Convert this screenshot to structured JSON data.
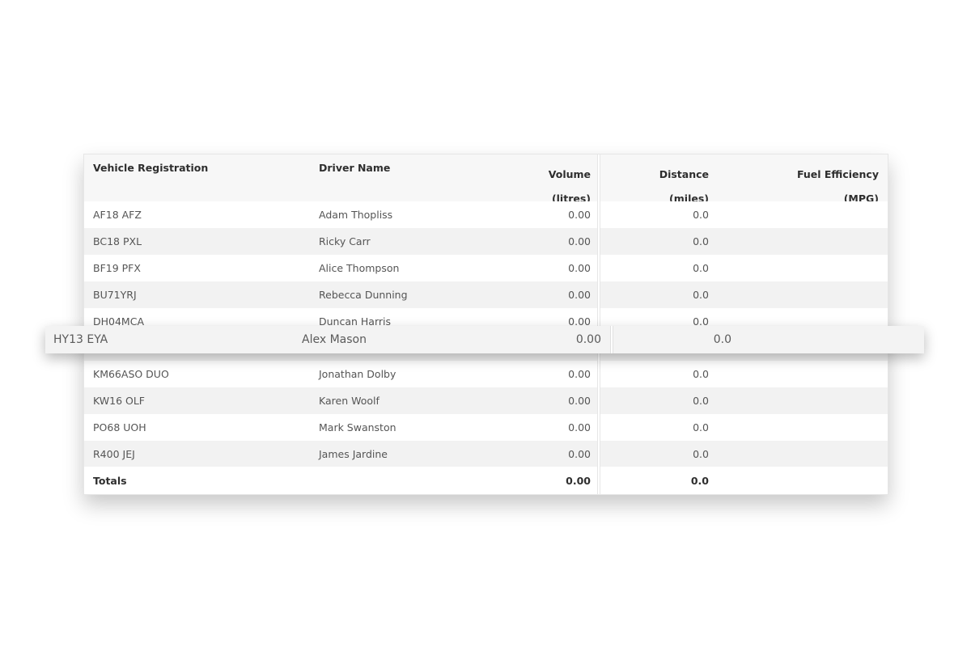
{
  "table": {
    "columns": {
      "registration": "Vehicle Registration",
      "driver": "Driver Name",
      "volume": "Volume",
      "volume_unit": "(litres)",
      "distance": "Distance",
      "distance_unit": "(miles)",
      "efficiency": "Fuel Efficiency",
      "efficiency_unit": "(MPG)"
    },
    "rows": [
      {
        "registration": "AF18 AFZ",
        "driver": "Adam Thopliss",
        "volume": "0.00",
        "distance": "0.0",
        "efficiency": ""
      },
      {
        "registration": "BC18 PXL",
        "driver": "Ricky Carr",
        "volume": "0.00",
        "distance": "0.0",
        "efficiency": ""
      },
      {
        "registration": "BF19 PFX",
        "driver": "Alice Thompson",
        "volume": "0.00",
        "distance": "0.0",
        "efficiency": ""
      },
      {
        "registration": "BU71YRJ",
        "driver": "Rebecca Dunning",
        "volume": "0.00",
        "distance": "0.0",
        "efficiency": ""
      },
      {
        "registration": "DH04MCA",
        "driver": "Duncan Harris",
        "volume": "0.00",
        "distance": "0.0",
        "efficiency": ""
      },
      {
        "registration": "",
        "driver": "",
        "volume": "",
        "distance": "",
        "efficiency": ""
      },
      {
        "registration": "KM66ASO DUO",
        "driver": "Jonathan Dolby",
        "volume": "0.00",
        "distance": "0.0",
        "efficiency": ""
      },
      {
        "registration": "KW16 OLF",
        "driver": "Karen Woolf",
        "volume": "0.00",
        "distance": "0.0",
        "efficiency": ""
      },
      {
        "registration": "PO68 UOH",
        "driver": "Mark Swanston",
        "volume": "0.00",
        "distance": "0.0",
        "efficiency": ""
      },
      {
        "registration": "R400 JEJ",
        "driver": "James Jardine",
        "volume": "0.00",
        "distance": "0.0",
        "efficiency": ""
      }
    ],
    "highlighted_row": {
      "registration": "HY13 EYA",
      "driver": "Alex Mason",
      "volume": "0.00",
      "distance": "0.0"
    },
    "totals": {
      "label": "Totals",
      "volume": "0.00",
      "distance": "0.0",
      "efficiency": ""
    }
  }
}
